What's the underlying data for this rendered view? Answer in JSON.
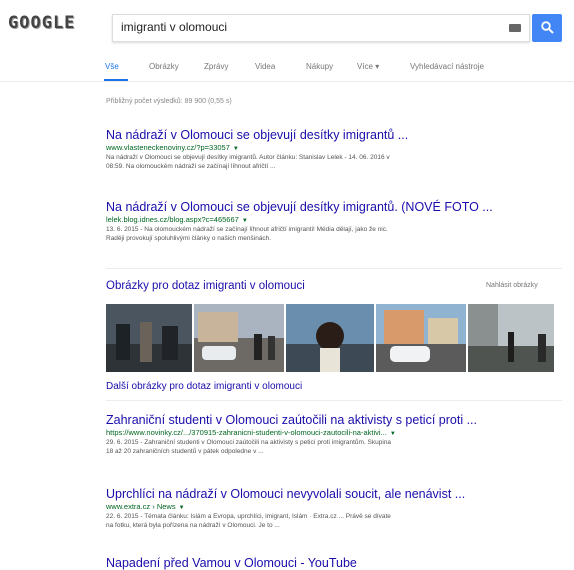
{
  "header": {
    "logo": "GOOGLE",
    "query": "imigranti v olomouci"
  },
  "tabs": [
    {
      "label": "Vše",
      "active": true
    },
    {
      "label": "Obrázky"
    },
    {
      "label": "Zprávy"
    },
    {
      "label": "Videa"
    },
    {
      "label": "Nákupy"
    },
    {
      "label": "Více ▾"
    },
    {
      "label": "Vyhledávací nástroje"
    }
  ],
  "stats": "Přibližný počet výsledků: 89 900 (0,55 s)",
  "results": [
    {
      "title": "Na nádraží v Olomouci se objevují desítky imigrantů ...",
      "url": "www.vlasteneckenoviny.cz/?p=33057",
      "snippet1": "Na nádraží v Olomouci se objevují desítky imigrantů. Autor článku: Stanislav Lelek - 14. 06. 2016 v",
      "snippet2": "08:59. Na olomouckém nádraží se začínají líhnout afričtí ..."
    },
    {
      "title": "Na nádraží v Olomouci se objevují desítky imigrantů. (NOVÉ FOTO ...",
      "url": "lelek.blog.idnes.cz/blog.aspx?c=465667",
      "snippet1": "13. 6. 2015 - Na olomouckém nádraží se začínají líhnout afričtí imigranti! Média dělají, jako že nic.",
      "snippet2": "Raději provokují spoluhlivými články o našich menšinách."
    }
  ],
  "images": {
    "title": "Obrázky pro dotaz imigranti v olomouci",
    "report": "Nahlásit obrázky",
    "more": "Další obrázky pro dotaz imigranti v olomouci"
  },
  "results2": [
    {
      "title": "Zahraniční studenti v Olomouci zaútočili na aktivisty s peticí proti ...",
      "url": "https://www.novinky.cz/.../370915-zahranicni-studenti-v-olomouci-zautocili-na-aktivi...",
      "snippet1": "29. 6. 2015 - Zahraniční studenti v Olomouci zaútočili na aktivisty s peticí proti imigrantům. Skupina",
      "snippet2": "18 až 20 zahraničních studentů v pátek odpoledne v ..."
    },
    {
      "title": "Uprchlíci na nádraží v Olomouci nevyvolali soucit, ale nenávist ...",
      "url": "www.extra.cz › News",
      "snippet1": "22. 6. 2015 - Témata článku: Islám a Evropa, uprchlíci, imigrant, Islám · Extra.cz ... Právě se dívate",
      "snippet2": "na fotku, která byla pořízena na nádraží v Olomouci. Je to ..."
    },
    {
      "title": "Napadení před Vamou v Olomouci - YouTube",
      "url": "",
      "snippet1": "",
      "snippet2": ""
    }
  ],
  "colors": {
    "link": "#1a0dab",
    "url": "#006621",
    "accent": "#4285f4"
  }
}
